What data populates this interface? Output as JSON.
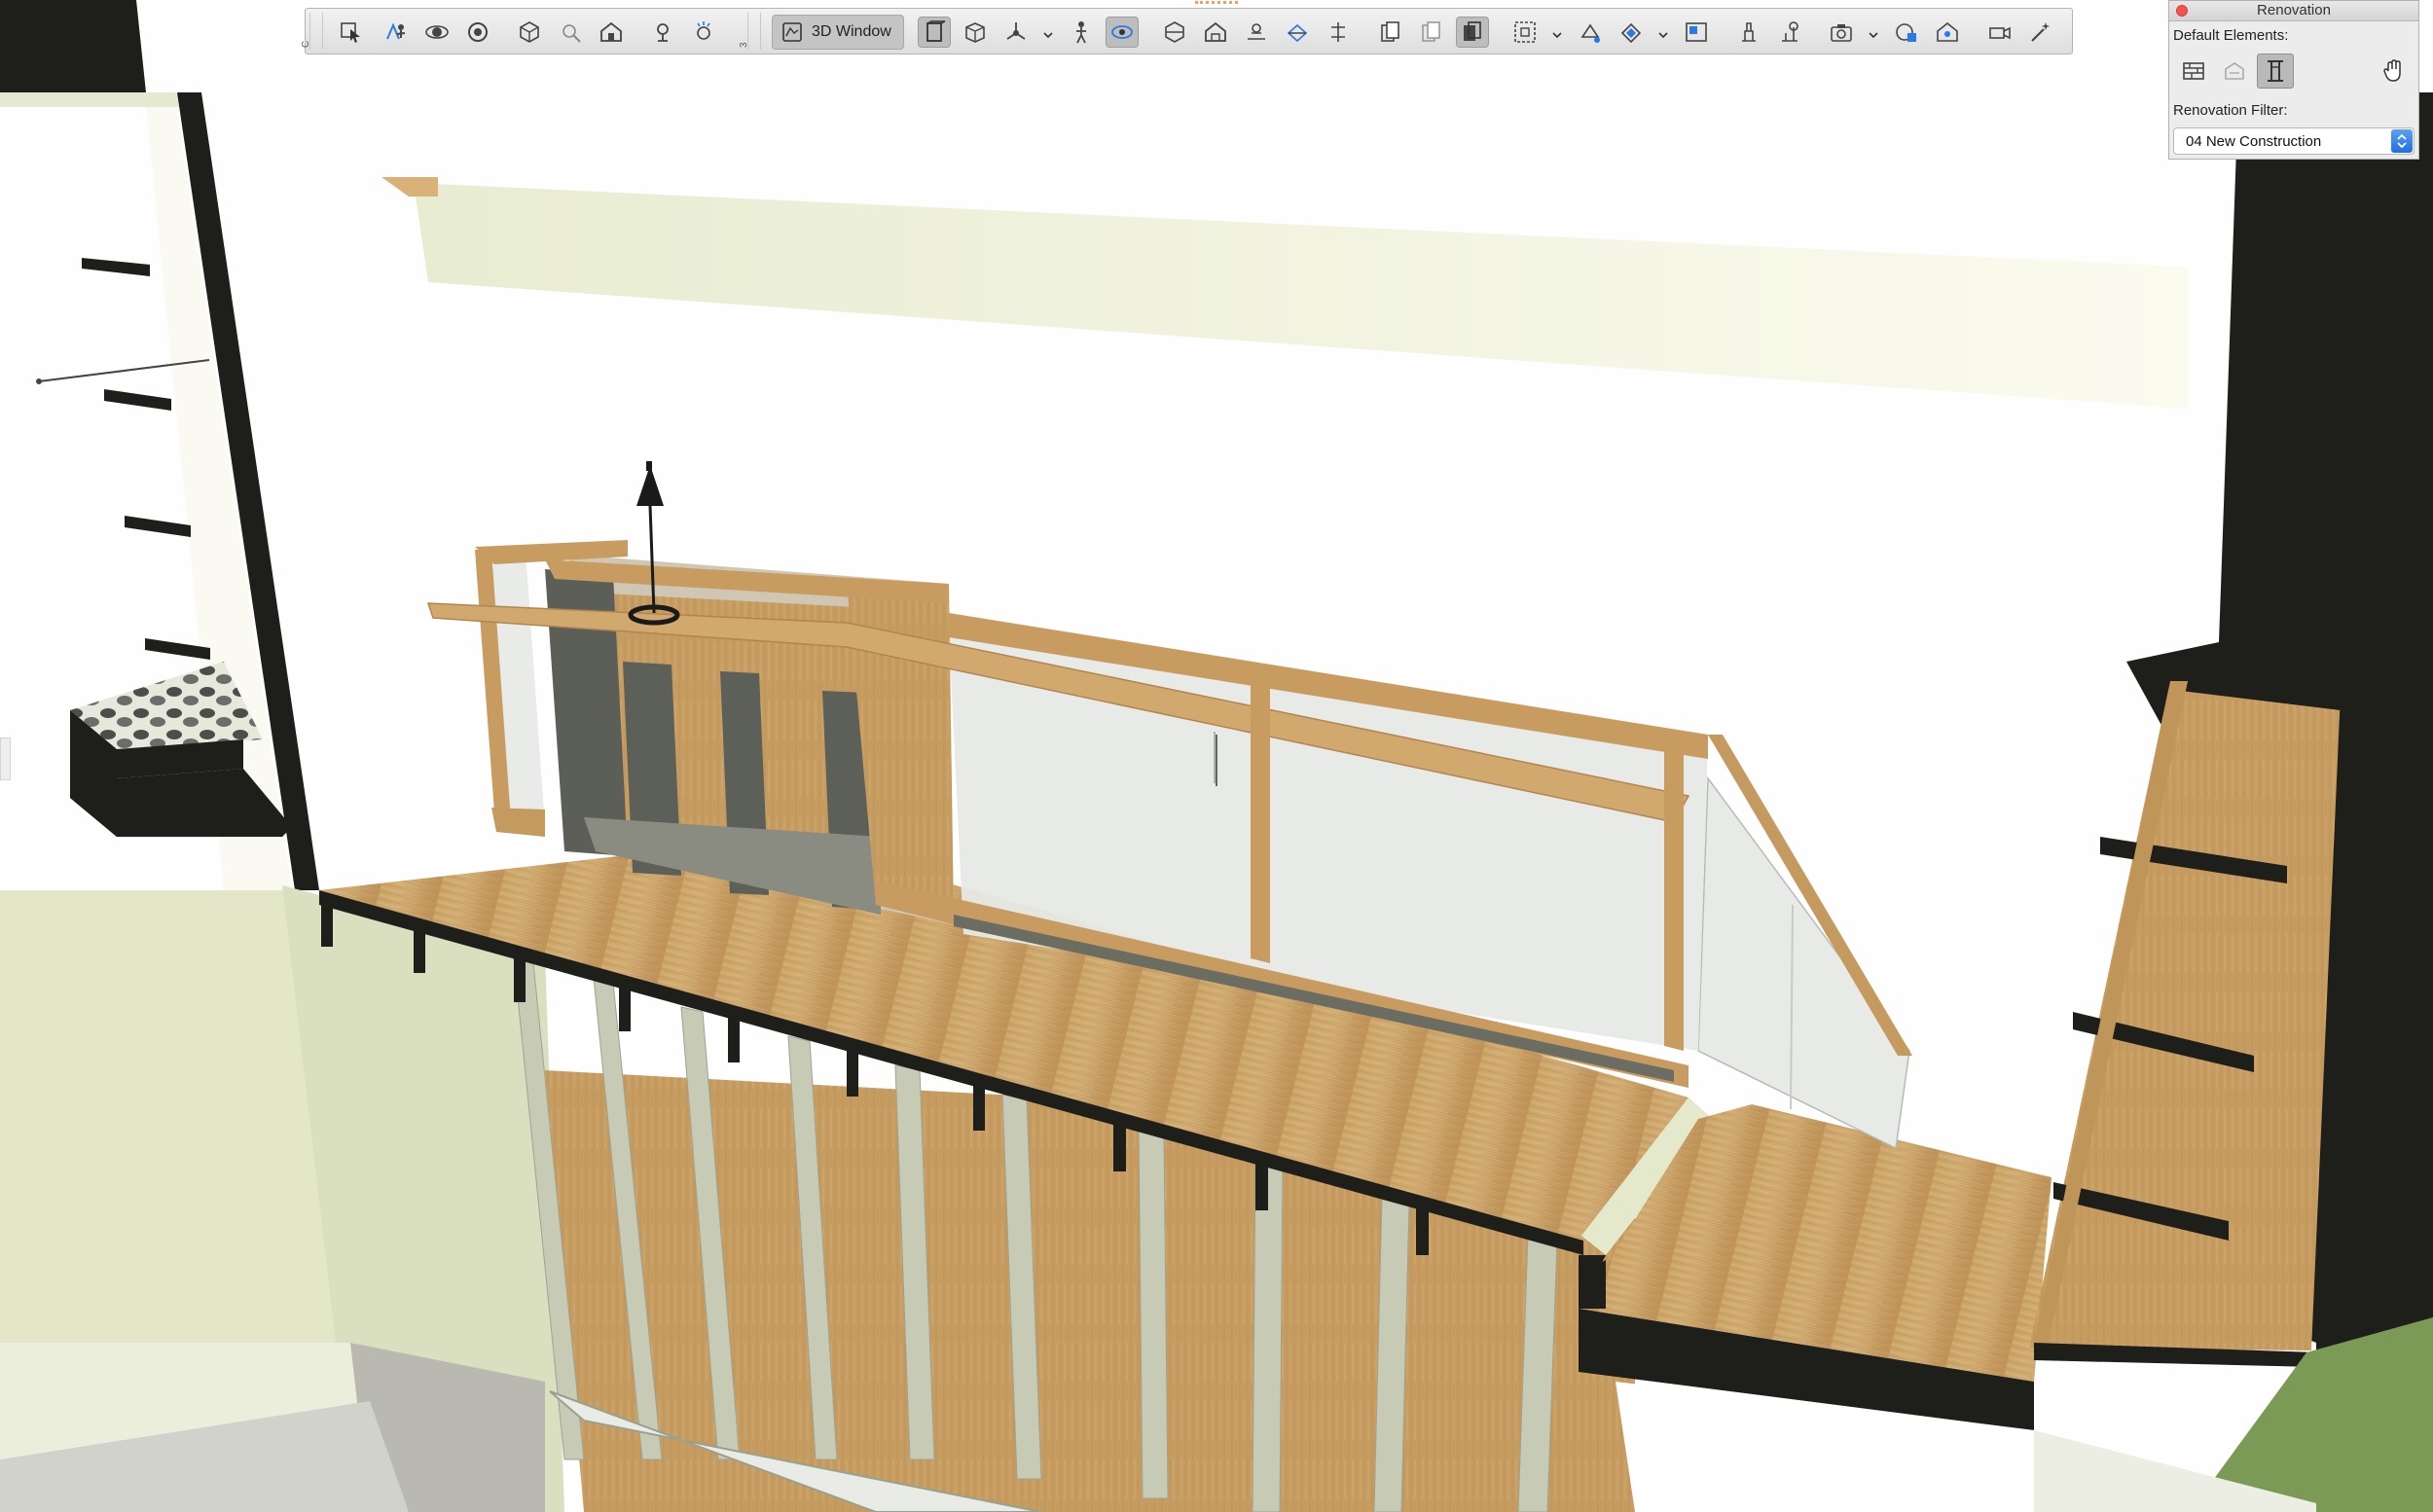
{
  "toolbar": {
    "window_button_label": "3D Window",
    "grip_left_label": "C",
    "grip_mid_label": "3",
    "buttons": [
      {
        "icon": "selection-arrow-icon"
      },
      {
        "icon": "walk-icon"
      },
      {
        "icon": "orbit-icon"
      },
      {
        "icon": "rotate-view-icon"
      },
      {
        "icon": "fit-view-icon"
      },
      {
        "icon": "filter-cut-icon"
      },
      {
        "icon": "house-icon"
      },
      {
        "icon": "light-icon"
      },
      {
        "icon": "sun-icon"
      },
      {
        "icon": "wall-icon"
      },
      {
        "icon": "box-icon"
      },
      {
        "icon": "axonometry-icon"
      },
      {
        "icon": "person-icon"
      },
      {
        "icon": "eye-hand-icon"
      },
      {
        "icon": "section-icon"
      },
      {
        "icon": "home-plan-icon"
      },
      {
        "icon": "floor-icon"
      },
      {
        "icon": "wireframe-icon"
      },
      {
        "icon": "elevation-icon"
      },
      {
        "icon": "stack-icon"
      },
      {
        "icon": "copy-icon"
      },
      {
        "icon": "layer-icon"
      },
      {
        "icon": "marquee-icon"
      },
      {
        "icon": "paint-icon"
      },
      {
        "icon": "material-icon"
      },
      {
        "icon": "layout-icon"
      },
      {
        "icon": "brush-icon"
      },
      {
        "icon": "tree-icon"
      },
      {
        "icon": "camera-icon"
      },
      {
        "icon": "render-icon"
      },
      {
        "icon": "sun-study-icon"
      },
      {
        "icon": "video-camera-icon"
      },
      {
        "icon": "magic-wand-icon"
      }
    ]
  },
  "renovation": {
    "title": "Renovation",
    "default_elements_label": "Default Elements:",
    "filter_label": "Renovation Filter:",
    "filter_value": "04 New Construction",
    "element_buttons": [
      {
        "icon": "existing-element-icon",
        "active": false
      },
      {
        "icon": "demolish-element-icon",
        "active": false
      },
      {
        "icon": "new-element-icon",
        "active": true
      }
    ],
    "hand-tool": {
      "icon": "hand-icon"
    }
  },
  "colors": {
    "wood": "#c59a5f",
    "wood_light": "#d6b47e",
    "section_black": "#1e1f1a",
    "wall_pale": "#dde2c4",
    "glass": "#e6e9e6",
    "accent_blue": "#2a79e8"
  }
}
